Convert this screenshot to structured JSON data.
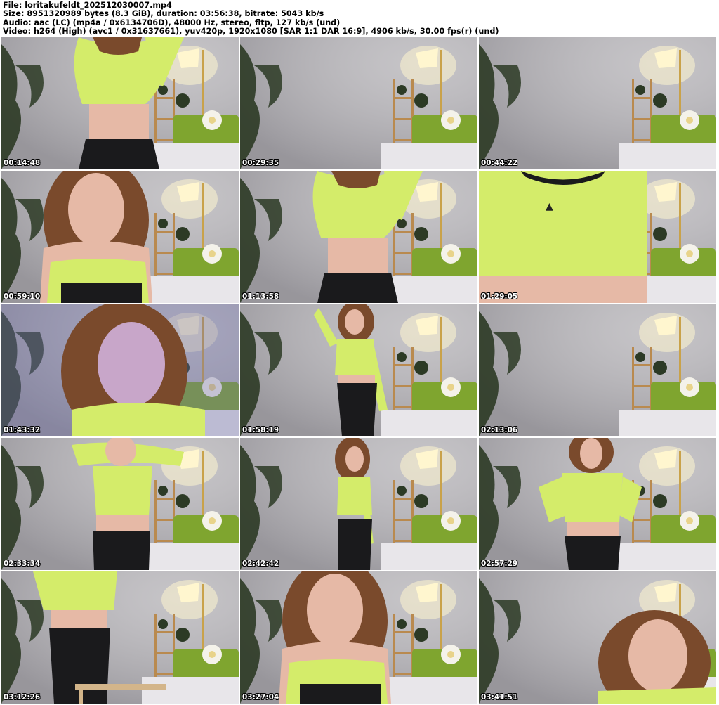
{
  "header": {
    "file_line": "File: loritakufeldt_202512030007.mp4",
    "size_line": "Size: 8951320989 bytes (8.3 GiB), duration: 03:56:38, bitrate: 5043 kb/s",
    "audio_line": "Audio: aac (LC) (mp4a / 0x6134706D), 48000 Hz, stereo, fltp, 127 kb/s (und)",
    "video_line": "Video: h264 (High) (avc1 / 0x31637661), yuv420p, 1920x1080 [SAR 1:1 DAR 16:9], 4906 kb/s, 30.00 fps(r) (und)"
  },
  "thumbnails": [
    {
      "timestamp": "00:14:48",
      "scene": "torso-arm-up"
    },
    {
      "timestamp": "00:29:35",
      "scene": "empty-room"
    },
    {
      "timestamp": "00:44:22",
      "scene": "empty-room"
    },
    {
      "timestamp": "00:59:10",
      "scene": "face-close"
    },
    {
      "timestamp": "01:13:58",
      "scene": "torso-arm-up"
    },
    {
      "timestamp": "01:29:05",
      "scene": "shirt-close"
    },
    {
      "timestamp": "01:43:32",
      "scene": "face-blue-light"
    },
    {
      "timestamp": "01:58:19",
      "scene": "full-body"
    },
    {
      "timestamp": "02:13:06",
      "scene": "empty-room"
    },
    {
      "timestamp": "02:33:34",
      "scene": "arms-up"
    },
    {
      "timestamp": "02:42:42",
      "scene": "full-body-side"
    },
    {
      "timestamp": "02:57:29",
      "scene": "torso-arms-hips"
    },
    {
      "timestamp": "03:12:26",
      "scene": "torso-chair"
    },
    {
      "timestamp": "03:27:04",
      "scene": "face-close"
    },
    {
      "timestamp": "03:41:51",
      "scene": "face-corner"
    }
  ],
  "colors": {
    "wall": "#b9b7bb",
    "shirt": "#d4ec6a",
    "sofa": "#7fa52f",
    "bed": "#e8e6ea",
    "plant": "#2c3a25",
    "lamp": "#fff6cf",
    "hair": "#7a4a2c",
    "skin": "#e6b9a6",
    "pants": "#1a1a1c",
    "timestamp": "#ffffff"
  }
}
